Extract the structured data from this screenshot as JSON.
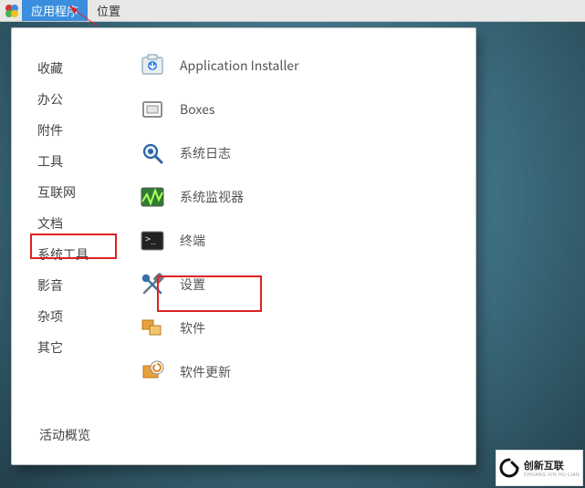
{
  "topbar": {
    "applications": "应用程序",
    "places": "位置"
  },
  "categories": [
    "收藏",
    "办公",
    "附件",
    "工具",
    "互联网",
    "文档",
    "系统工具",
    "影音",
    "杂项",
    "其它"
  ],
  "apps": [
    {
      "icon": "application-installer-icon",
      "label": "Application Installer"
    },
    {
      "icon": "boxes-icon",
      "label": "Boxes"
    },
    {
      "icon": "logs-icon",
      "label": "系统日志"
    },
    {
      "icon": "system-monitor-icon",
      "label": "系统监视器"
    },
    {
      "icon": "terminal-icon",
      "label": "终端"
    },
    {
      "icon": "settings-icon",
      "label": "设置"
    },
    {
      "icon": "software-icon",
      "label": "软件"
    },
    {
      "icon": "software-update-icon",
      "label": "软件更新"
    }
  ],
  "footer": {
    "activities": "活动概览"
  },
  "watermark": {
    "brand": "创新互联",
    "sub": "CHUANG XIN HU LIAN"
  }
}
